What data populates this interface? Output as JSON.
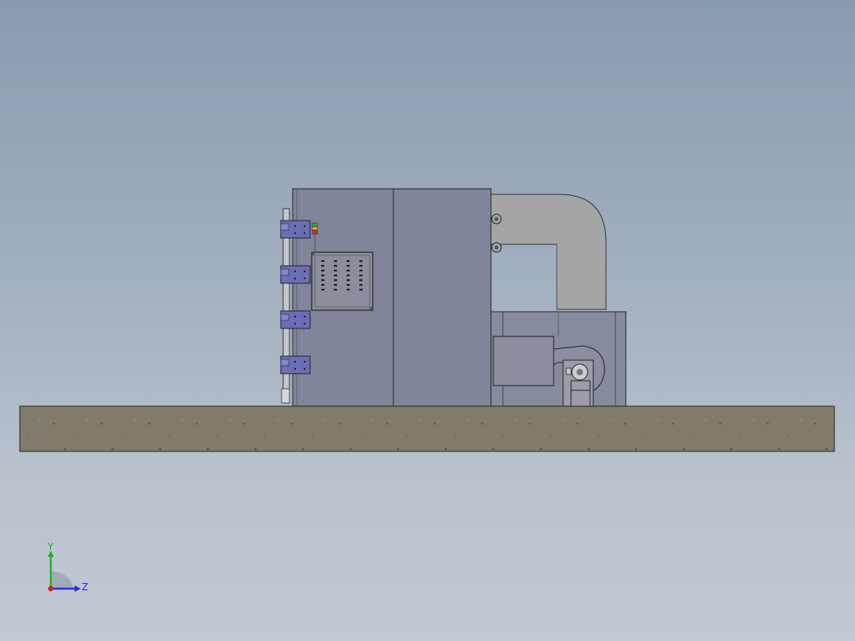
{
  "viewport": {
    "background_top": "#8a9bb0",
    "background_bottom": "#c2c9d2"
  },
  "model": {
    "cabinet_color": "#80859a",
    "duct_color": "#a5a5a5",
    "fan_color": "#8a8ea0",
    "latch_color": "#6c6fb6",
    "base_color": "#7f7a6a",
    "control_panel_color": "#8b8e9c"
  },
  "triad": {
    "y_label": "Y",
    "z_label": "Z",
    "y_color": "#1db31d",
    "z_color": "#2b2be0",
    "x_color": "#d01e1e"
  }
}
